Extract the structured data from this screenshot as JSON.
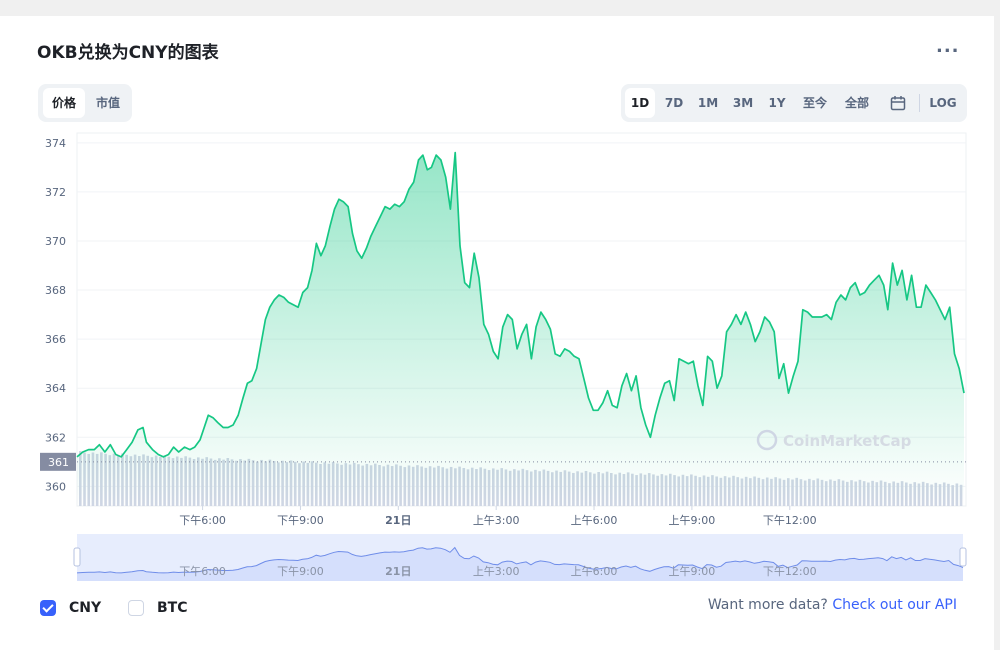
{
  "header": {
    "title": "OKB兑换为CNY的图表",
    "more_label": "..."
  },
  "toggle": {
    "items": [
      "价格",
      "市值"
    ],
    "active": 0
  },
  "ranges": {
    "items": [
      "1D",
      "7D",
      "1M",
      "3M",
      "1Y",
      "至今",
      "全部"
    ],
    "active": 0,
    "log_label": "LOG"
  },
  "legend": {
    "cny": "CNY",
    "btc": "BTC",
    "cny_checked": true,
    "btc_checked": false
  },
  "footer": {
    "prefix": "Want more data? ",
    "link": "Check out our API"
  },
  "watermark": "CoinMarketCap",
  "colors": {
    "line": "#16c784",
    "volume": "#cfd6e4",
    "accent": "#3861fb",
    "current_badge": "#858ca2"
  },
  "chart_data": {
    "type": "area",
    "current_value": 361,
    "current_label": "361",
    "ylim": [
      359.2,
      374.4
    ],
    "y_ticks": [
      374,
      372,
      370,
      368,
      366,
      364,
      362,
      360
    ],
    "x_ticks": [
      {
        "label": "下午6:00",
        "t": 6
      },
      {
        "label": "下午9:00",
        "t": 9
      },
      {
        "label": "21日",
        "t": 12
      },
      {
        "label": "上午3:00",
        "t": 15
      },
      {
        "label": "上午6:00",
        "t": 18
      },
      {
        "label": "上午9:00",
        "t": 21
      },
      {
        "label": "下午12:00",
        "t": 24
      }
    ],
    "xlim": [
      2.15,
      26.0
    ],
    "series": [
      {
        "points": [
          [
            2.16,
            361.2
          ],
          [
            2.33,
            361.4
          ],
          [
            2.5,
            361.5
          ],
          [
            2.67,
            361.5
          ],
          [
            2.82,
            361.7
          ],
          [
            2.98,
            361.4
          ],
          [
            3.14,
            361.7
          ],
          [
            3.3,
            361.3
          ],
          [
            3.46,
            361.2
          ],
          [
            3.62,
            361.5
          ],
          [
            3.78,
            361.8
          ],
          [
            3.95,
            362.3
          ],
          [
            4.1,
            362.4
          ],
          [
            4.2,
            361.8
          ],
          [
            4.38,
            361.5
          ],
          [
            4.55,
            361.3
          ],
          [
            4.7,
            361.2
          ],
          [
            4.85,
            361.3
          ],
          [
            5.0,
            361.6
          ],
          [
            5.15,
            361.4
          ],
          [
            5.32,
            361.6
          ],
          [
            5.48,
            361.5
          ],
          [
            5.62,
            361.6
          ],
          [
            5.78,
            361.9
          ],
          [
            5.9,
            362.4
          ],
          [
            6.02,
            362.9
          ],
          [
            6.16,
            362.8
          ],
          [
            6.3,
            362.6
          ],
          [
            6.46,
            362.4
          ],
          [
            6.6,
            362.4
          ],
          [
            6.75,
            362.5
          ],
          [
            6.9,
            362.9
          ],
          [
            7.04,
            363.6
          ],
          [
            7.17,
            364.2
          ],
          [
            7.3,
            364.3
          ],
          [
            7.44,
            364.8
          ],
          [
            7.57,
            365.8
          ],
          [
            7.7,
            366.8
          ],
          [
            7.83,
            367.3
          ],
          [
            7.96,
            367.6
          ],
          [
            8.1,
            367.8
          ],
          [
            8.24,
            367.7
          ],
          [
            8.38,
            367.5
          ],
          [
            8.52,
            367.4
          ],
          [
            8.66,
            367.3
          ],
          [
            8.8,
            367.9
          ],
          [
            8.94,
            368.1
          ],
          [
            9.07,
            368.8
          ],
          [
            9.2,
            369.9
          ],
          [
            9.33,
            369.4
          ],
          [
            9.46,
            369.8
          ],
          [
            9.6,
            370.6
          ],
          [
            9.73,
            371.3
          ],
          [
            9.86,
            371.7
          ],
          [
            9.99,
            371.6
          ],
          [
            10.13,
            371.4
          ],
          [
            10.26,
            370.3
          ],
          [
            10.39,
            369.6
          ],
          [
            10.53,
            369.3
          ],
          [
            10.67,
            369.7
          ],
          [
            10.8,
            370.2
          ],
          [
            10.94,
            370.6
          ],
          [
            11.08,
            371.0
          ],
          [
            11.22,
            371.4
          ],
          [
            11.36,
            371.3
          ],
          [
            11.5,
            371.5
          ],
          [
            11.64,
            371.4
          ],
          [
            11.78,
            371.6
          ],
          [
            11.92,
            372.1
          ],
          [
            12.06,
            372.4
          ],
          [
            12.2,
            373.3
          ],
          [
            12.33,
            373.5
          ],
          [
            12.46,
            372.9
          ],
          [
            12.58,
            373.0
          ],
          [
            12.72,
            373.5
          ],
          [
            12.86,
            373.3
          ],
          [
            13.0,
            372.6
          ],
          [
            13.14,
            371.3
          ],
          [
            13.28,
            373.6
          ],
          [
            13.42,
            369.8
          ],
          [
            13.56,
            368.3
          ],
          [
            13.7,
            368.1
          ],
          [
            13.84,
            369.5
          ],
          [
            13.98,
            368.5
          ],
          [
            14.12,
            366.6
          ],
          [
            14.26,
            366.2
          ],
          [
            14.4,
            365.5
          ],
          [
            14.54,
            365.2
          ],
          [
            14.68,
            366.5
          ],
          [
            14.82,
            367.0
          ],
          [
            14.96,
            366.8
          ],
          [
            15.1,
            365.6
          ],
          [
            15.24,
            366.2
          ],
          [
            15.38,
            366.6
          ],
          [
            15.52,
            365.2
          ],
          [
            15.66,
            366.5
          ],
          [
            15.8,
            367.1
          ],
          [
            15.94,
            366.8
          ],
          [
            16.08,
            366.4
          ],
          [
            16.22,
            365.4
          ],
          [
            16.36,
            365.3
          ],
          [
            16.5,
            365.6
          ],
          [
            16.64,
            365.5
          ],
          [
            16.78,
            365.3
          ],
          [
            16.92,
            365.2
          ],
          [
            17.06,
            364.4
          ],
          [
            17.2,
            363.6
          ],
          [
            17.34,
            363.1
          ],
          [
            17.48,
            363.1
          ],
          [
            17.62,
            363.4
          ],
          [
            17.76,
            363.9
          ],
          [
            17.9,
            363.3
          ],
          [
            18.04,
            363.2
          ],
          [
            18.18,
            364.1
          ],
          [
            18.32,
            364.6
          ],
          [
            18.46,
            363.9
          ],
          [
            18.6,
            364.5
          ],
          [
            18.74,
            363.2
          ],
          [
            18.88,
            362.5
          ],
          [
            19.02,
            362.0
          ],
          [
            19.16,
            362.9
          ],
          [
            19.3,
            363.6
          ],
          [
            19.44,
            364.2
          ],
          [
            19.58,
            364.3
          ],
          [
            19.72,
            363.5
          ],
          [
            19.86,
            365.2
          ],
          [
            20.0,
            365.1
          ],
          [
            20.14,
            365.0
          ],
          [
            20.28,
            365.1
          ],
          [
            20.42,
            364.1
          ],
          [
            20.56,
            363.3
          ],
          [
            20.7,
            365.3
          ],
          [
            20.84,
            365.1
          ],
          [
            20.98,
            364.0
          ],
          [
            21.12,
            364.5
          ],
          [
            21.26,
            366.3
          ],
          [
            21.4,
            366.6
          ],
          [
            21.54,
            367.0
          ],
          [
            21.68,
            366.6
          ],
          [
            21.82,
            367.1
          ],
          [
            21.96,
            366.6
          ],
          [
            22.1,
            365.9
          ],
          [
            22.24,
            366.3
          ],
          [
            22.38,
            366.9
          ],
          [
            22.52,
            366.7
          ],
          [
            22.66,
            366.3
          ],
          [
            22.8,
            364.4
          ],
          [
            22.94,
            365.0
          ],
          [
            23.08,
            363.8
          ],
          [
            23.22,
            364.5
          ],
          [
            23.36,
            365.1
          ],
          [
            23.5,
            367.2
          ],
          [
            23.64,
            367.1
          ],
          [
            23.78,
            366.9
          ],
          [
            23.92,
            366.9
          ],
          [
            24.06,
            366.9
          ],
          [
            24.2,
            367.0
          ],
          [
            24.34,
            366.8
          ],
          [
            24.48,
            367.5
          ],
          [
            24.62,
            367.8
          ],
          [
            24.76,
            367.6
          ],
          [
            24.9,
            368.1
          ],
          [
            25.04,
            368.3
          ],
          [
            25.18,
            367.8
          ],
          [
            25.32,
            367.9
          ],
          [
            25.46,
            368.2
          ],
          [
            25.6,
            368.4
          ],
          [
            25.74,
            368.6
          ],
          [
            25.88,
            368.2
          ],
          [
            26.0,
            367.2
          ],
          [
            26.14,
            369.1
          ],
          [
            26.28,
            368.2
          ],
          [
            26.42,
            368.8
          ],
          [
            26.56,
            367.6
          ],
          [
            26.7,
            368.6
          ],
          [
            26.84,
            367.3
          ],
          [
            26.98,
            367.3
          ],
          [
            27.12,
            368.2
          ],
          [
            27.26,
            367.9
          ],
          [
            27.4,
            367.6
          ],
          [
            27.54,
            367.2
          ],
          [
            27.68,
            366.8
          ],
          [
            27.82,
            367.3
          ],
          [
            27.96,
            365.4
          ],
          [
            28.1,
            364.8
          ],
          [
            28.24,
            363.8
          ]
        ]
      }
    ],
    "mini_ticks": [
      "下午6:00",
      "下午9:00",
      "21日",
      "上午3:00",
      "上午6:00",
      "上午9:00",
      "下午12:00"
    ]
  }
}
